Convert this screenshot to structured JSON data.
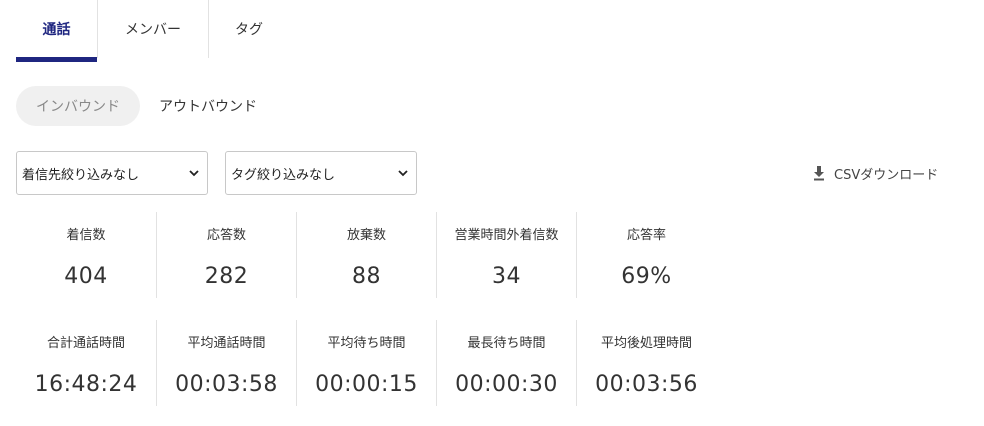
{
  "tabs": [
    {
      "label": "通話"
    },
    {
      "label": "メンバー"
    },
    {
      "label": "タグ"
    }
  ],
  "sub_tabs": [
    {
      "label": "インバウンド"
    },
    {
      "label": "アウトバウンド"
    }
  ],
  "filters": {
    "incoming_filter": "着信先絞り込みなし",
    "tag_filter": "タグ絞り込みなし"
  },
  "csv_download_label": "CSVダウンロード",
  "stats_row1": [
    {
      "label": "着信数",
      "value": "404"
    },
    {
      "label": "応答数",
      "value": "282"
    },
    {
      "label": "放棄数",
      "value": "88"
    },
    {
      "label": "営業時間外着信数",
      "value": "34"
    },
    {
      "label": "応答率",
      "value": "69%"
    }
  ],
  "stats_row2": [
    {
      "label": "合計通話時間",
      "value": "16:48:24"
    },
    {
      "label": "平均通話時間",
      "value": "00:03:58"
    },
    {
      "label": "平均待ち時間",
      "value": "00:00:15"
    },
    {
      "label": "最長待ち時間",
      "value": "00:00:30"
    },
    {
      "label": "平均後処理時間",
      "value": "00:03:56"
    }
  ],
  "colors": {
    "accent": "#1f2680",
    "pill_bg": "#f0f0f0"
  },
  "icons": {
    "download": "download-icon",
    "select_chevron": "chevron-down-icon"
  }
}
